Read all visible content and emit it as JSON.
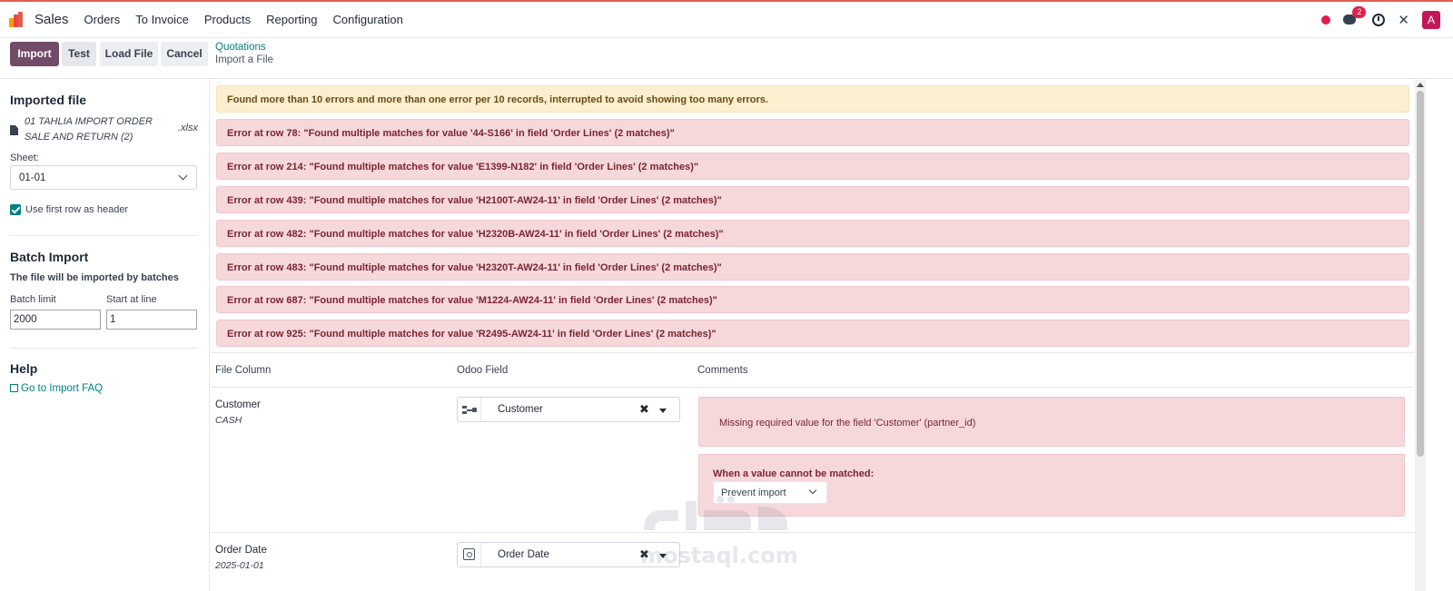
{
  "app": {
    "name": "Sales",
    "logo_colors": [
      "#f59e0b",
      "#ef4444",
      "#e05d4f",
      "#3b82f6"
    ]
  },
  "nav": {
    "items": [
      "Orders",
      "To Invoice",
      "Products",
      "Reporting",
      "Configuration"
    ]
  },
  "systray": {
    "chat_badge": "2",
    "avatar_letter": "A",
    "icons": [
      "status-dot-icon",
      "chat-icon",
      "clock-icon",
      "tools-icon"
    ]
  },
  "toolbar": {
    "import_label": "Import",
    "test_label": "Test",
    "load_file_label": "Load File",
    "cancel_label": "Cancel"
  },
  "breadcrumb": {
    "parent": "Quotations",
    "current": "Import a File"
  },
  "sidebar": {
    "imported_file_title": "Imported file",
    "file_name": "01 TAHLIA IMPORT ORDER SALE AND RETURN (2)",
    "file_ext": ".xlsx",
    "sheet_label": "Sheet:",
    "sheet_value": "01-01",
    "header_checkbox_label": "Use first row as header",
    "header_checkbox_checked": true,
    "batch_title": "Batch Import",
    "batch_desc": "The file will be imported by batches",
    "batch_limit_label": "Batch limit",
    "batch_limit_value": "2000",
    "start_line_label": "Start at line",
    "start_line_value": "1",
    "help_title": "Help",
    "faq_link": "Go to Import FAQ"
  },
  "alerts": {
    "warning": "Found more than 10 errors and more than one error per 10 records, interrupted to avoid showing too many errors.",
    "errors": [
      "Error at row 78: \"Found multiple matches for value '44-S166' in field 'Order Lines' (2 matches)\"",
      "Error at row 214: \"Found multiple matches for value 'E1399-N182' in field 'Order Lines' (2 matches)\"",
      "Error at row 439: \"Found multiple matches for value 'H2100T-AW24-11' in field 'Order Lines' (2 matches)\"",
      "Error at row 482: \"Found multiple matches for value 'H2320B-AW24-11' in field 'Order Lines' (2 matches)\"",
      "Error at row 483: \"Found multiple matches for value 'H2320T-AW24-11' in field 'Order Lines' (2 matches)\"",
      "Error at row 687: \"Found multiple matches for value 'M1224-AW24-11' in field 'Order Lines' (2 matches)\"",
      "Error at row 925: \"Found multiple matches for value 'R2495-AW24-11' in field 'Order Lines' (2 matches)\""
    ]
  },
  "table": {
    "headers": [
      "File Column",
      "Odoo Field",
      "Comments"
    ],
    "rows": [
      {
        "column": "Customer",
        "sample": "CASH",
        "field": "Customer",
        "comment": "Missing required value for the field 'Customer' (partner_id)",
        "unmatched_title": "When a value cannot be matched:",
        "unmatched_option": "Prevent import"
      },
      {
        "column": "Order Date",
        "sample": "2025-01-01",
        "field": "Order Date"
      }
    ]
  },
  "watermark": {
    "text": "mostaql.com"
  }
}
